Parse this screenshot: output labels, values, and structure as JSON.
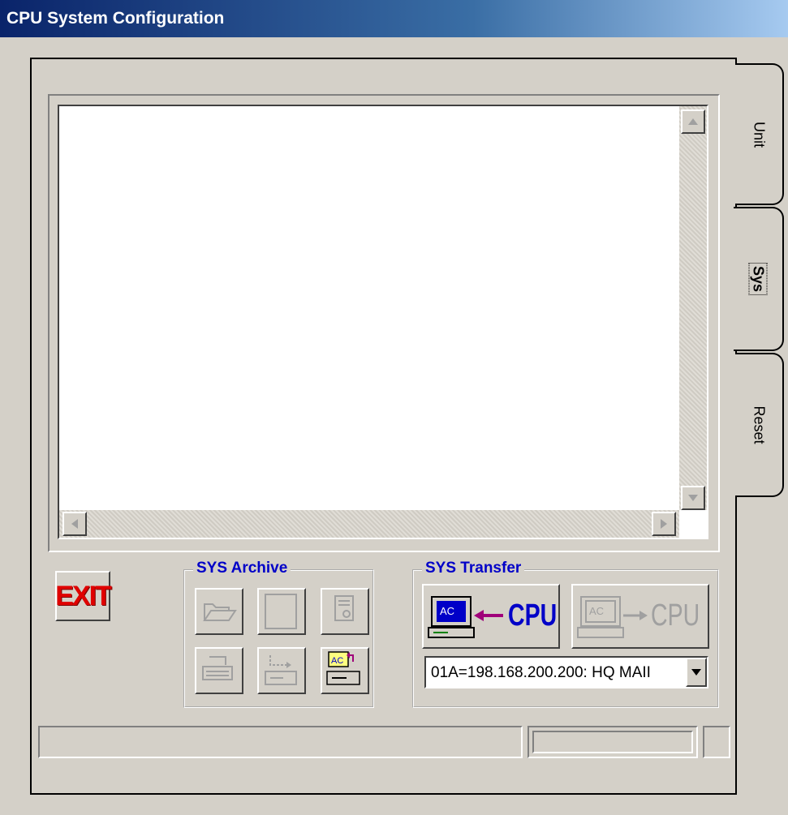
{
  "window": {
    "title": "CPU System Configuration"
  },
  "tabs": [
    {
      "label": "Unit",
      "active": false
    },
    {
      "label": "Sys",
      "active": true
    },
    {
      "label": "Reset",
      "active": false
    }
  ],
  "buttons": {
    "exit_label": "EXIT"
  },
  "sys_archive": {
    "title": "SYS Archive",
    "buttons": [
      {
        "icon": "folder-open-icon",
        "enabled": false
      },
      {
        "icon": "blank-page-icon",
        "enabled": false
      },
      {
        "icon": "document-settings-icon",
        "enabled": false
      },
      {
        "icon": "printer-icon",
        "enabled": false
      },
      {
        "icon": "save-to-drive-icon",
        "enabled": false
      },
      {
        "icon": "ac-to-drive-icon",
        "enabled": true
      }
    ]
  },
  "sys_transfer": {
    "title": "SYS Transfer",
    "from_cpu": {
      "screen_label": "AC",
      "label": "CPU",
      "enabled": true
    },
    "to_cpu": {
      "screen_label": "AC",
      "label": "CPU",
      "enabled": false
    },
    "target": {
      "value": "01A=198.168.200.200: HQ MAII"
    }
  },
  "colors": {
    "accent": "#0000c8",
    "exit": "#e00000",
    "arrow": "#a0007a",
    "title_start": "#0a246a",
    "title_end": "#a6caf0"
  }
}
